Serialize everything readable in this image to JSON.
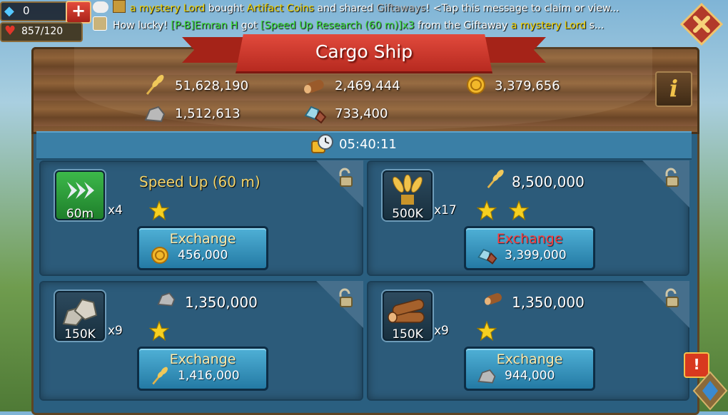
{
  "hud": {
    "gems": "0",
    "hearts": "857/120"
  },
  "chat": {
    "line1": {
      "name": "a mystery Lord",
      "t1": " bought ",
      "item": "Artifact Coins",
      "t2": " and shared ",
      "gift": "Giftaways",
      "t3": "! <Tap this message to claim or view..."
    },
    "line2": {
      "t1": "How lucky! ",
      "player": "[P-B]Emran H",
      "t2": " got ",
      "item": "[Speed Up Research (60 m)]x3",
      "t3": " from the Giftaway ",
      "lord": "a mystery Lord",
      "t4": " s..."
    }
  },
  "title": "Cargo Ship",
  "resources": {
    "food": "51,628,190",
    "wood": "2,469,444",
    "gold": "3,379,656",
    "stone": "1,512,613",
    "ore": "733,400"
  },
  "timer": "05:40:11",
  "cards": [
    {
      "item_label": "60m",
      "multiplier": "x4",
      "title": "Speed Up (60 m)",
      "stars": 1,
      "button": "Exchange",
      "price": "456,000",
      "price_icon": "gold-coin-icon"
    },
    {
      "item_label": "500K",
      "multiplier": "x17",
      "title": "8,500,000",
      "stars": 2,
      "button": "Exchange",
      "price": "3,399,000",
      "price_icon": "ore-icon"
    },
    {
      "item_label": "150K",
      "multiplier": "x9",
      "title": "1,350,000",
      "stars": 1,
      "button": "Exchange",
      "price": "1,416,000",
      "price_icon": "wheat-icon"
    },
    {
      "item_label": "150K",
      "multiplier": "x9",
      "title": "1,350,000",
      "stars": 1,
      "button": "Exchange",
      "price": "944,000",
      "price_icon": "stone-icon"
    }
  ],
  "colors": {
    "button_warning": "#ff3b3b",
    "title_banner": "#d63b2f"
  }
}
